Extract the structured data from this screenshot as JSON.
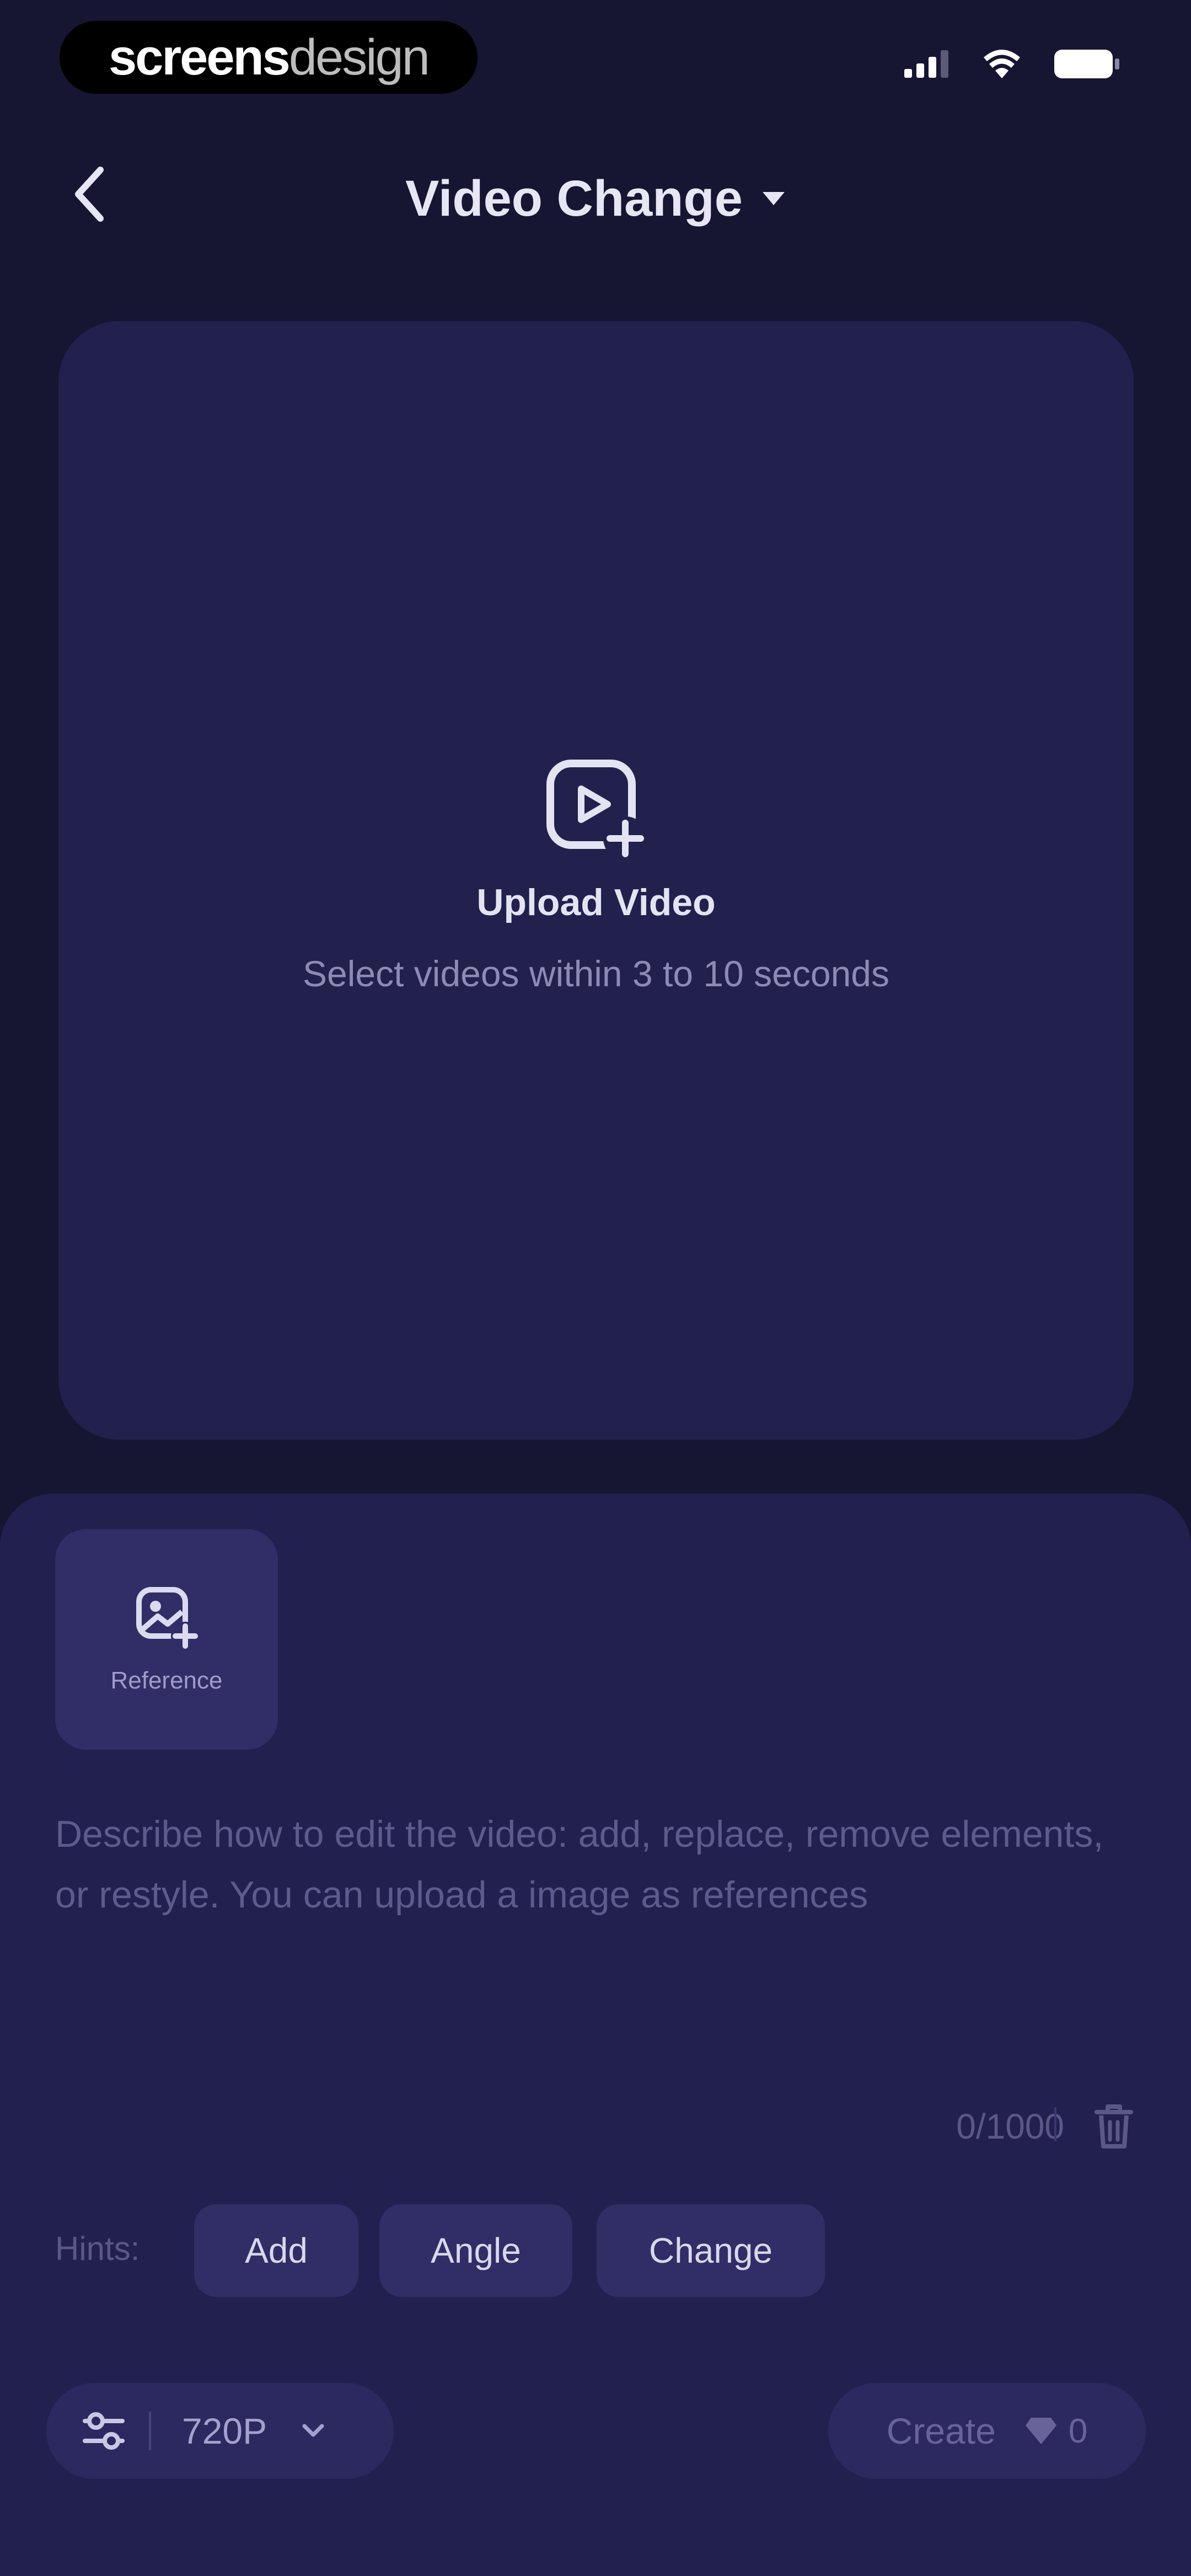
{
  "watermark": {
    "part1": "screens",
    "part2": "design"
  },
  "header": {
    "title": "Video Change"
  },
  "upload": {
    "title": "Upload Video",
    "subtitle": "Select videos within 3 to 10 seconds"
  },
  "reference": {
    "label": "Reference"
  },
  "prompt": {
    "placeholder": "Describe how to edit the video: add, replace, remove elements, or restyle. You can upload a image as references",
    "counter": "0/1000"
  },
  "hints": {
    "label": "Hints:",
    "chips": [
      "Add",
      "Angle",
      "Change"
    ]
  },
  "footer": {
    "quality": "720P",
    "create_label": "Create",
    "credits": "0"
  },
  "icons": {
    "back": "chevron-left-icon",
    "title_dropdown": "caret-down-icon",
    "upload": "video-plus-icon",
    "reference": "image-plus-icon",
    "trash": "trash-icon",
    "settings": "sliders-icon",
    "quality_dropdown": "chevron-down-icon",
    "credit": "diamond-icon"
  },
  "colors": {
    "background": "#161532",
    "card": "#22204d",
    "chip": "#312d66",
    "text": "#e9e8f6",
    "muted": "#5d5a8d"
  }
}
